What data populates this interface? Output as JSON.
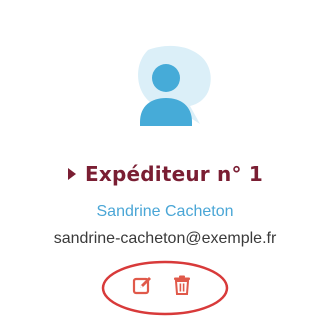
{
  "sender": {
    "title": "Expéditeur n° 1",
    "name": "Sandrine Cacheton",
    "email": "sandrine-cacheton@exemple.fr"
  },
  "actions": {
    "edit_icon": "edit-icon",
    "delete_icon": "trash-icon"
  },
  "colors": {
    "title": "#7a1e33",
    "name": "#4aa6d6",
    "avatar": "#46abd8",
    "avatar_bubble": "#dbeff8",
    "action_icon": "#e0594a",
    "highlight_ring": "#d83a3a",
    "email": "#3a3a3a"
  }
}
